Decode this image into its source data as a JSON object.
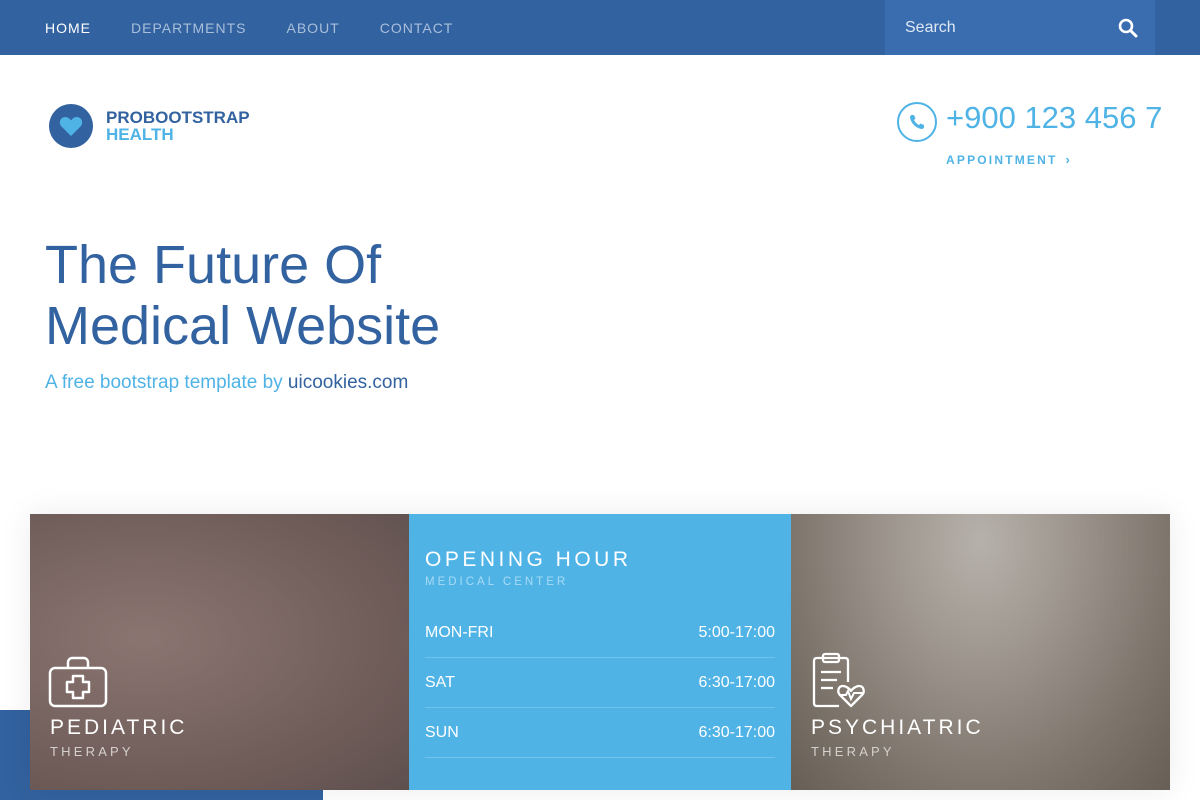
{
  "nav": {
    "items": [
      {
        "label": "HOME",
        "active": true
      },
      {
        "label": "DEPARTMENTS",
        "active": false
      },
      {
        "label": "ABOUT",
        "active": false
      },
      {
        "label": "CONTACT",
        "active": false
      }
    ],
    "search_placeholder": "Search",
    "search_icon": "search-icon"
  },
  "brand": {
    "line1": "PROBOOTSTRAP",
    "line2": "HEALTH",
    "icon": "heart-icon"
  },
  "contact": {
    "phone": "+900 123 456 7",
    "appointment_label": "APPOINTMENT",
    "appointment_chevron": "›",
    "phone_icon": "phone-icon"
  },
  "hero": {
    "title_line1": "The Future Of",
    "title_line2": "Medical Website",
    "subtitle_prefix": "A free bootstrap template by ",
    "subtitle_link": "uicookies.com"
  },
  "cards": {
    "pediatric": {
      "title": "PEDIATRIC",
      "subtitle": "THERAPY",
      "icon": "medical-kit-icon"
    },
    "hours": {
      "title": "OPENING HOUR",
      "subtitle": "MEDICAL CENTER",
      "rows": [
        {
          "day": "MON-FRI",
          "time": "5:00-17:00"
        },
        {
          "day": "SAT",
          "time": "6:30-17:00"
        },
        {
          "day": "SUN",
          "time": "6:30-17:00"
        }
      ]
    },
    "psychiatric": {
      "title": "PSYCHIATRIC",
      "subtitle": "THERAPY",
      "icon": "clipboard-heart-icon"
    }
  },
  "colors": {
    "primary": "#32629f",
    "accent": "#4fb3e6",
    "search_bg": "#3a6daf"
  }
}
